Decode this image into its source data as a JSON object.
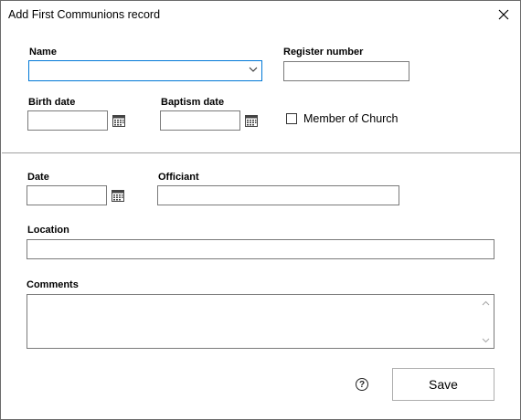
{
  "window": {
    "title": "Add First Communions record",
    "close_icon": "close-icon"
  },
  "form": {
    "name": {
      "label": "Name",
      "value": ""
    },
    "register_number": {
      "label": "Register number",
      "value": ""
    },
    "birth_date": {
      "label": "Birth date",
      "value": ""
    },
    "baptism_date": {
      "label": "Baptism date",
      "value": ""
    },
    "member_of_church": {
      "label": "Member of Church",
      "checked": false
    },
    "date": {
      "label": "Date",
      "value": ""
    },
    "officiant": {
      "label": "Officiant",
      "value": ""
    },
    "location": {
      "label": "Location",
      "value": ""
    },
    "comments": {
      "label": "Comments",
      "value": ""
    }
  },
  "footer": {
    "help_icon": "help-icon",
    "help_glyph": "?",
    "save_label": "Save"
  },
  "colors": {
    "focus_border": "#0078d7",
    "border": "#7a7a7a"
  }
}
